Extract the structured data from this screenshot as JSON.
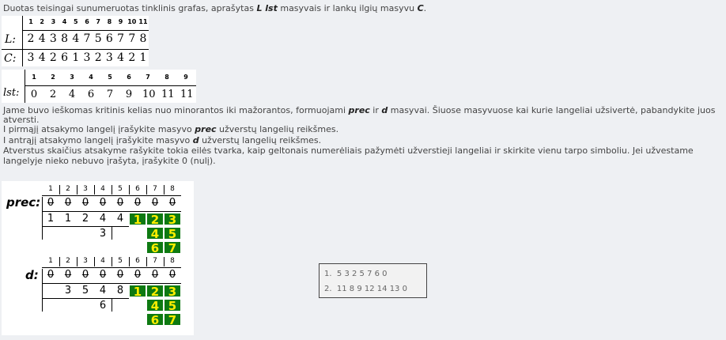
{
  "intro": {
    "pre": "Duotas teisingai sunumeruotas tinklinis grafas, aprašytas ",
    "arrays": "L lst",
    "mid": " masyvais ir lankų ilgių masyvu ",
    "c": "C",
    "end": "."
  },
  "lc": {
    "label_l": "L:",
    "label_c": "C:",
    "indices": [
      "1",
      "2",
      "3",
      "4",
      "5",
      "6",
      "7",
      "8",
      "9",
      "10",
      "11"
    ],
    "l_values": [
      "2",
      "4",
      "3",
      "8",
      "4",
      "7",
      "5",
      "6",
      "7",
      "7",
      "8"
    ],
    "c_values": [
      "3",
      "4",
      "2",
      "6",
      "1",
      "3",
      "2",
      "3",
      "4",
      "2",
      "1"
    ]
  },
  "lst": {
    "label": "lst:",
    "indices": [
      "1",
      "2",
      "3",
      "4",
      "5",
      "6",
      "7",
      "8",
      "9"
    ],
    "values": [
      "0",
      "2",
      "4",
      "6",
      "7",
      "9",
      "10",
      "11",
      "11"
    ]
  },
  "desc": {
    "line1_pre": "Jame buvo ieškomas kritinis kelias nuo minorantos iki mažorantos, formuojami ",
    "prec": "prec",
    "ir": " ir ",
    "d": "d",
    "line1_post": " masyvai. Šiuose masyvuose kai kurie langeliai užsivertė, pabandykite juos",
    "line2": "atversti.",
    "line3_pre": "I pirmąjį atsakymo langelį įrašykite masyvo ",
    "line3_post": " užverstų langelių reikšmes.",
    "line4_pre": "I antrąjį atsakymo langelį įrašykite masyvo ",
    "line4_post": " užverstų langelių reikšmes.",
    "line5": "Atverstus skaičius atsakyme rašykite tokia eilės tvarka, kaip geltonais numerėliais pažymėti užverstieji langeliai ir skirkite vienu tarpo simboliu. Jei užvestame",
    "line6": "langelyje nieko nebuvo įrašyta, įrašykite 0 (nulį)."
  },
  "prec": {
    "label": "prec:",
    "indices": [
      "1",
      "2",
      "3",
      "4",
      "5",
      "6",
      "7",
      "8"
    ],
    "row0": [
      "0",
      "0",
      "0",
      "0",
      "0",
      "0",
      "0",
      "0"
    ],
    "row1": [
      "1",
      "1",
      "2",
      "4",
      "4"
    ],
    "row2_col4": "3",
    "green": [
      "1",
      "2",
      "3",
      "4",
      "5",
      "6",
      "7"
    ]
  },
  "d": {
    "label": "d:",
    "indices": [
      "1",
      "2",
      "3",
      "4",
      "5",
      "6",
      "7",
      "8"
    ],
    "row0": [
      "0",
      "0",
      "0",
      "0",
      "0",
      "0",
      "0",
      "0"
    ],
    "row1": [
      "3",
      "5",
      "4",
      "8"
    ],
    "row2_col4": "6",
    "green": [
      "1",
      "2",
      "3",
      "4",
      "5",
      "6",
      "7"
    ]
  },
  "answers": {
    "a1_num": "1.",
    "a1_val": "5 3 2 5 7 6 0",
    "a2_num": "2.",
    "a2_val": "11 8 9 12 14 13 0"
  }
}
